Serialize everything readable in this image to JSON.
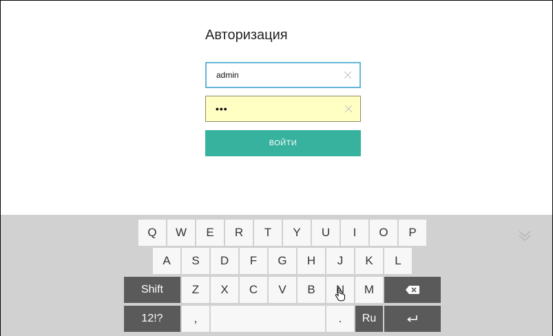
{
  "login": {
    "title": "Авторизация",
    "username_value": "admin",
    "password_value": "•••",
    "submit_label": "ВОЙТИ",
    "colors": {
      "accent": "#37b29e",
      "username_border": "#62b6d8",
      "password_bg": "#ffffc4"
    }
  },
  "keyboard": {
    "row1": [
      "Q",
      "W",
      "E",
      "R",
      "T",
      "Y",
      "U",
      "I",
      "O",
      "P"
    ],
    "row2": [
      "A",
      "S",
      "D",
      "F",
      "G",
      "H",
      "J",
      "K",
      "L"
    ],
    "row3": [
      "Z",
      "X",
      "C",
      "V",
      "B",
      "N",
      "M"
    ],
    "shift_label": "Shift",
    "symbols_label": "12!?",
    "comma_label": ",",
    "period_label": ".",
    "lang_label": "Ru",
    "backspace_icon": "backspace-icon",
    "enter_icon": "enter-icon",
    "collapse_icon": "chevron-double-down-icon"
  }
}
